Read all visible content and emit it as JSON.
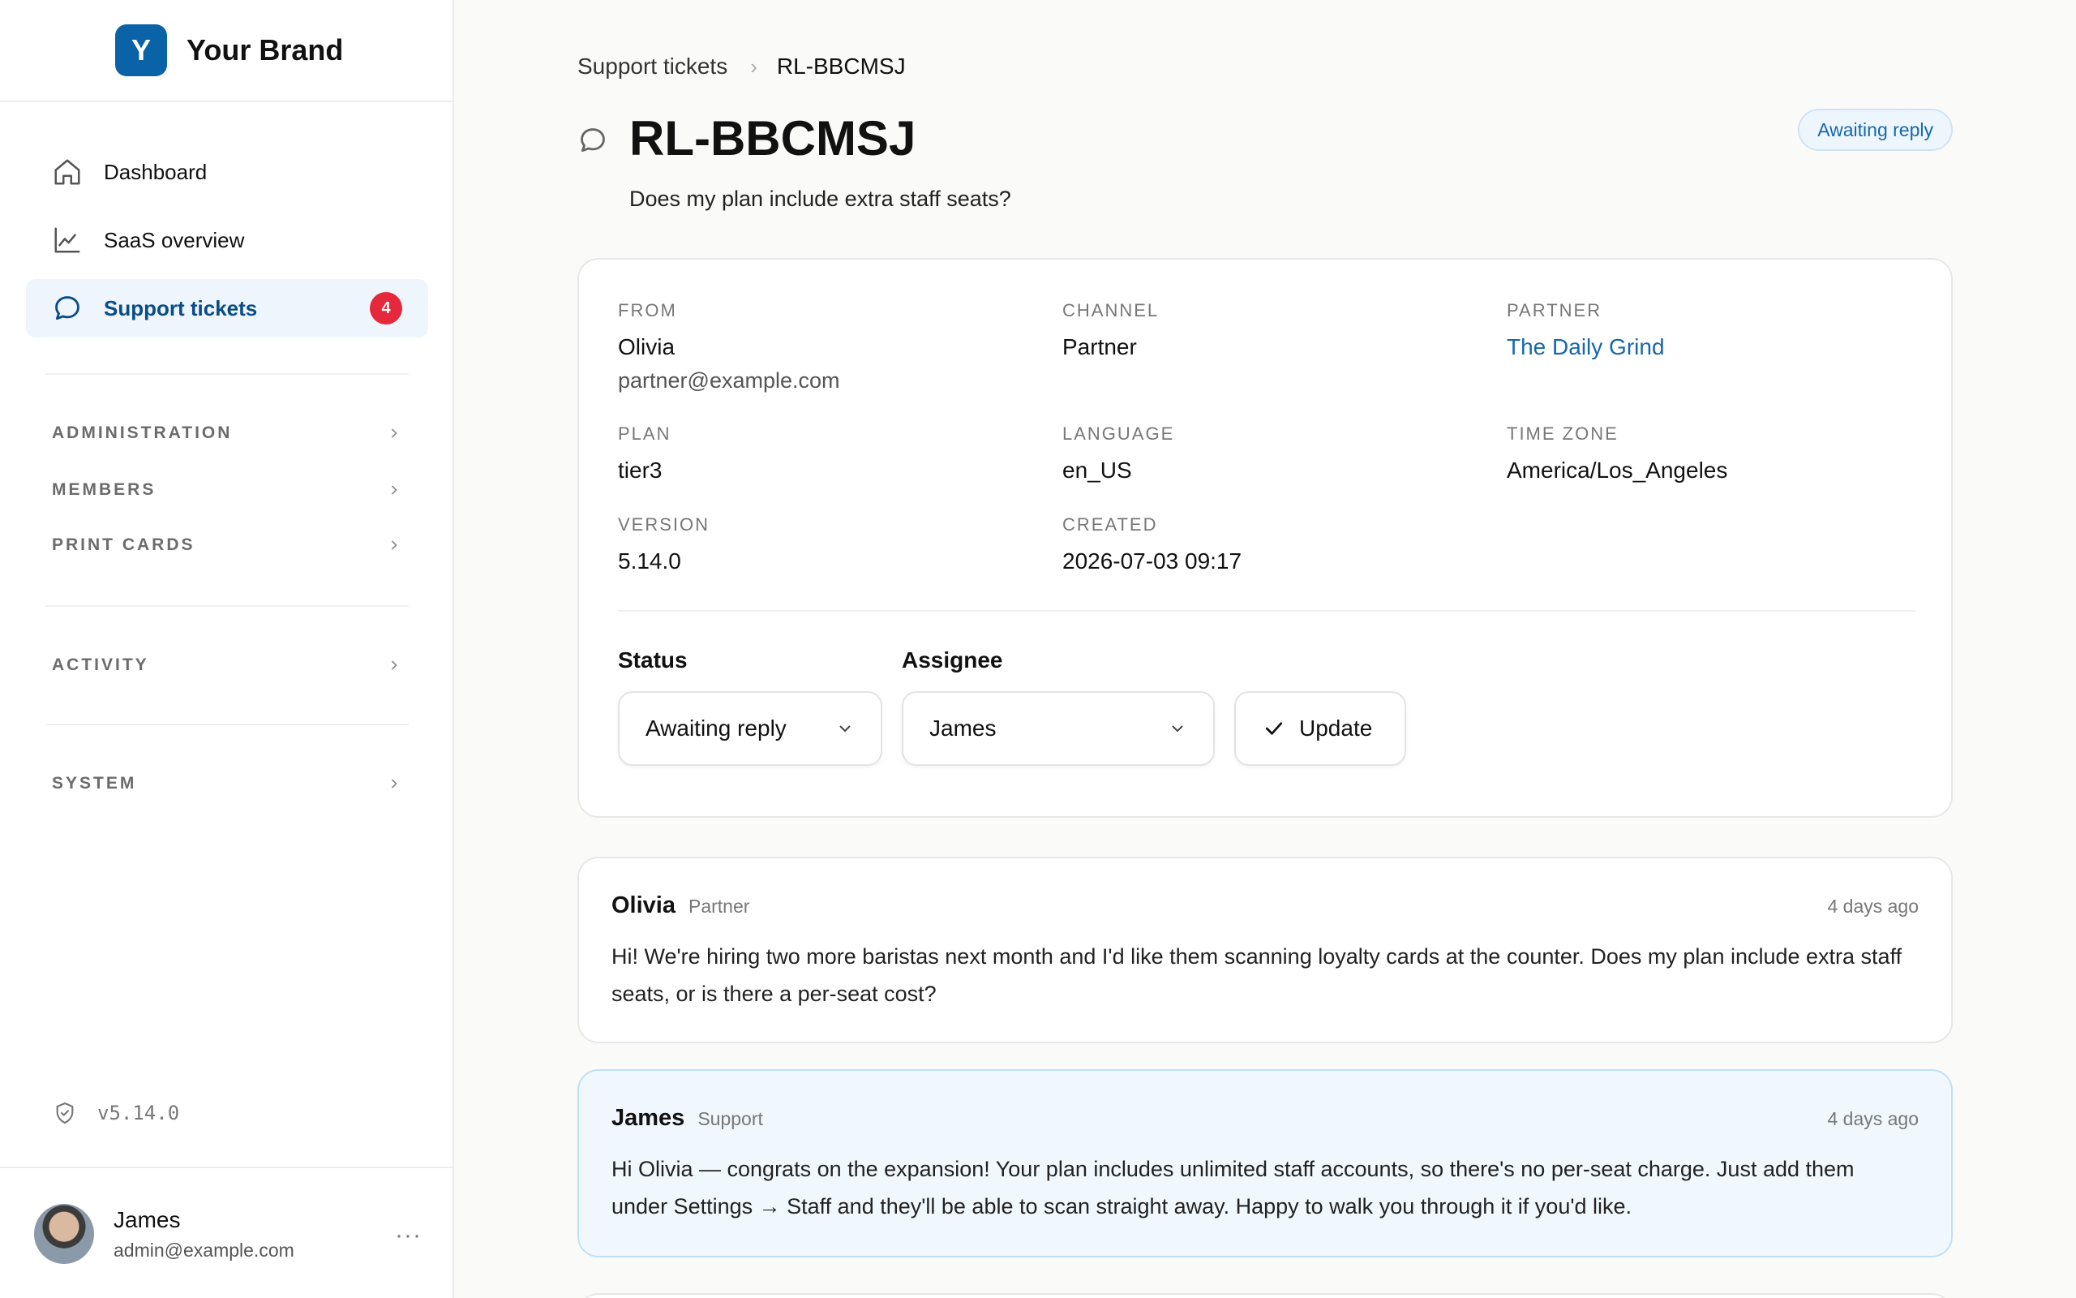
{
  "brand": {
    "logo_letter": "Y",
    "name": "Your Brand",
    "color": "#0a63a6"
  },
  "nav": {
    "items": [
      {
        "label": "Dashboard",
        "icon": "home-icon"
      },
      {
        "label": "SaaS overview",
        "icon": "chart-line-icon"
      },
      {
        "label": "Support tickets",
        "icon": "chat-bubble-icon",
        "badge": "4",
        "active": true
      }
    ],
    "sections": [
      {
        "label": "ADMINISTRATION"
      },
      {
        "label": "MEMBERS"
      },
      {
        "label": "PRINT CARDS"
      },
      {
        "label": "ACTIVITY"
      },
      {
        "label": "SYSTEM"
      }
    ],
    "version": "v5.14.0"
  },
  "user": {
    "name": "James",
    "email": "admin@example.com",
    "more": "···"
  },
  "breadcrumb": {
    "parent": "Support tickets",
    "current": "RL-BBCMSJ"
  },
  "ticket": {
    "id": "RL-BBCMSJ",
    "subject": "Does my plan include extra staff seats?",
    "status_badge": "Awaiting reply",
    "fields": {
      "from_label": "FROM",
      "from_name": "Olivia",
      "from_email": "partner@example.com",
      "channel_label": "CHANNEL",
      "channel": "Partner",
      "partner_label": "PARTNER",
      "partner": "The Daily Grind",
      "plan_label": "PLAN",
      "plan": "tier3",
      "language_label": "LANGUAGE",
      "language": "en_US",
      "timezone_label": "TIME ZONE",
      "timezone": "America/Los_Angeles",
      "version_label": "VERSION",
      "version": "5.14.0",
      "created_label": "CREATED",
      "created": "2026-07-03 09:17"
    },
    "controls": {
      "status_label": "Status",
      "status_value": "Awaiting reply",
      "assignee_label": "Assignee",
      "assignee_value": "James",
      "update_label": "Update"
    }
  },
  "messages": [
    {
      "author": "Olivia",
      "role": "Partner",
      "time": "4 days ago",
      "body": "Hi! We're hiring two more baristas next month and I'd like them scanning loyalty cards at the counter. Does my plan include extra staff seats, or is there a per-seat cost?"
    },
    {
      "author": "James",
      "role": "Support",
      "time": "4 days ago",
      "body": "Hi Olivia — congrats on the expansion! Your plan includes unlimited staff accounts, so there's no per-seat charge. Just add them under Settings → Staff and they'll be able to scan straight away. Happy to walk you through it if you'd like."
    }
  ],
  "colors": {
    "accent": "#1767ab",
    "badge_red": "#e5283b",
    "active_bg": "#eef5fd"
  }
}
